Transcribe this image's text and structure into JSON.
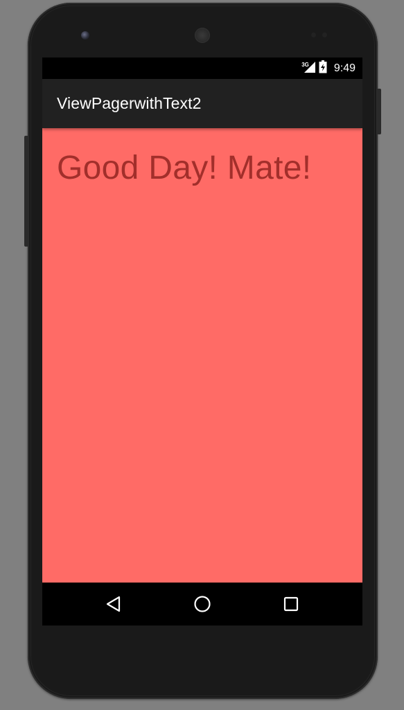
{
  "status_bar": {
    "network_type": "3G",
    "time": "9:49"
  },
  "action_bar": {
    "title": "ViewPagerwithText2"
  },
  "page": {
    "text": "Good Day! Mate!",
    "background_color": "#ff6b66",
    "text_color": "#a22f2b"
  },
  "nav_bar": {
    "back_icon": "back-triangle-icon",
    "home_icon": "home-circle-icon",
    "recents_icon": "recents-square-icon"
  }
}
